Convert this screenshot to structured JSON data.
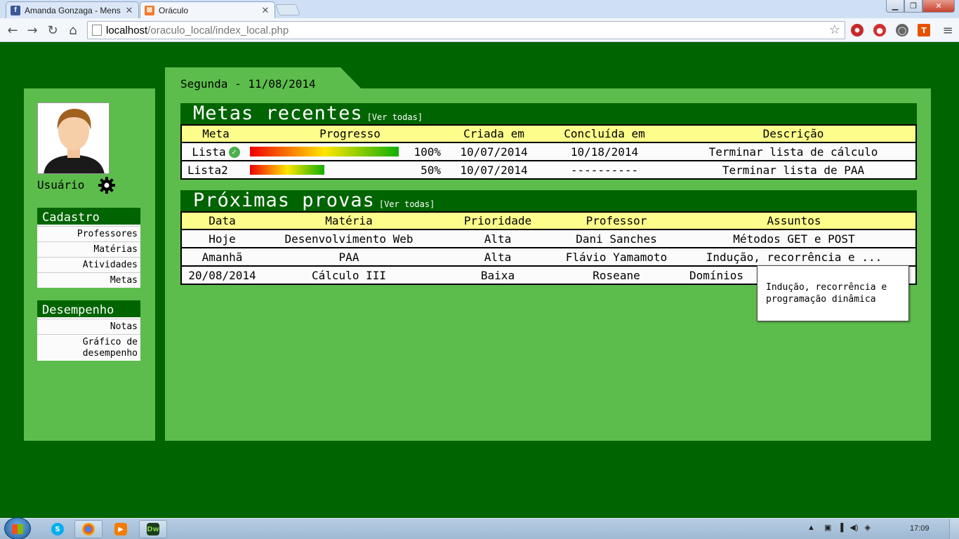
{
  "browser": {
    "tabs": [
      {
        "title": "Amanda Gonzaga - Mens",
        "favicon": "facebook-icon",
        "active": false
      },
      {
        "title": "Oráculo",
        "favicon": "xampp-icon",
        "active": true
      }
    ],
    "url_host": "localhost",
    "url_path": "/oraculo_local/index_local.php"
  },
  "sidebar": {
    "user_label": "Usuário",
    "cadastro": {
      "title": "Cadastro",
      "items": [
        "Professores",
        "Matérias",
        "Atividades",
        "Metas"
      ]
    },
    "desempenho": {
      "title": "Desempenho",
      "items": [
        "Notas",
        "Gráfico de desempenho"
      ]
    }
  },
  "main": {
    "date": "Segunda - 11/08/2014",
    "goals": {
      "title": "Metas recentes",
      "see_all": "[Ver todas]",
      "headers": [
        "Meta",
        "Progresso",
        "Criada em",
        "Concluída em",
        "Descrição"
      ],
      "rows": [
        {
          "meta": "Lista",
          "completed": true,
          "progress": 1.0,
          "progress_label": "100%",
          "created": "10/07/2014",
          "finished": "10/18/2014",
          "description": "Terminar lista de cálculo"
        },
        {
          "meta": "Lista2",
          "completed": false,
          "progress": 0.5,
          "progress_label": "50%",
          "created": "10/07/2014",
          "finished": "----------",
          "description": "Terminar lista de PAA"
        }
      ]
    },
    "exams": {
      "title": "Próximas provas",
      "see_all": "[Ver todas]",
      "headers": [
        "Data",
        "Matéria",
        "Prioridade",
        "Professor",
        "Assuntos"
      ],
      "rows": [
        {
          "date": "Hoje",
          "subject": "Desenvolvimento Web",
          "priority": "Alta",
          "teacher": "Dani Sanches",
          "topics": "Métodos GET e POST"
        },
        {
          "date": "Amanhã",
          "subject": "PAA",
          "priority": "Alta",
          "teacher": "Flávio Yamamoto",
          "topics": "Indução, recorrência e ..."
        },
        {
          "date": "20/08/2014",
          "subject": "Cálculo III",
          "priority": "Baixa",
          "teacher": "Roseane",
          "topics": "Domínios"
        }
      ]
    },
    "tooltip": "Indução, recorrência e programação dinâmica"
  },
  "taskbar": {
    "apps": [
      "skype-icon",
      "chrome-icon",
      "media-player-icon",
      "dreamweaver-icon"
    ],
    "dw_label": "Dw",
    "clock": "17:09"
  },
  "colors": {
    "page_bg": "#006400",
    "panel_bg": "#5cbd4c",
    "header_row": "#fdfd8c"
  }
}
